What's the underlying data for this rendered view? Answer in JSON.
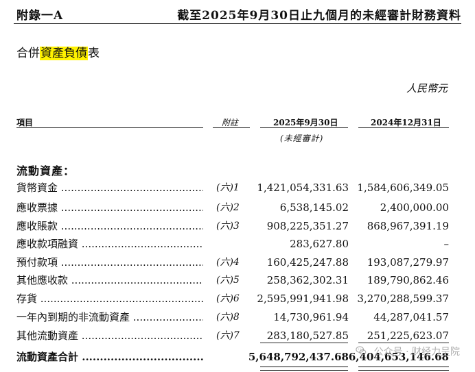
{
  "header": {
    "appendix": "附錄一A",
    "period_title": "截至2025年9月30日止九個月的未經審計財務資料"
  },
  "statement": {
    "title_prefix": "合併",
    "title_highlight": "資產負債",
    "title_suffix": "表",
    "currency": "人民幣元"
  },
  "columns": {
    "items": "項目",
    "note": "附註",
    "col_2025": "2025年9月30日",
    "col_2024": "2024年12月31日",
    "unaudited": "(未經審計)"
  },
  "section": {
    "title": "流動資產："
  },
  "rows": [
    {
      "label": "貨幣資金",
      "note": "(六)1",
      "v2025": "1,421,054,331.63",
      "v2024": "1,584,606,349.05"
    },
    {
      "label": "應收票據",
      "note": "(六)2",
      "v2025": "6,538,145.02",
      "v2024": "2,400,000.00"
    },
    {
      "label": "應收賬款",
      "note": "(六)3",
      "v2025": "908,225,351.27",
      "v2024": "868,967,391.19"
    },
    {
      "label": "應收款項融資",
      "note": "",
      "v2025": "283,627.80",
      "v2024": "–"
    },
    {
      "label": "預付款項",
      "note": "(六)4",
      "v2025": "160,425,247.88",
      "v2024": "193,087,279.97"
    },
    {
      "label": "其他應收款",
      "note": "(六)5",
      "v2025": "258,362,302.31",
      "v2024": "189,790,862.46"
    },
    {
      "label": "存貨",
      "note": "(六)6",
      "v2025": "2,595,991,941.98",
      "v2024": "3,270,288,599.37"
    },
    {
      "label": "一年內到期的非流動資產",
      "note": "(六)8",
      "v2025": "14,730,961.94",
      "v2024": "44,287,041.57"
    },
    {
      "label": "其他流動資產",
      "note": "(六)7",
      "v2025": "283,180,527.85",
      "v2024": "251,225,623.07"
    }
  ],
  "total": {
    "label": "流動資產合計",
    "v2025": "5,648,792,437.68",
    "v2024": "6,404,653,146.68"
  },
  "watermark": {
    "text": "公众号 · 财经力呈院",
    "icon": "wechat-icon"
  }
}
